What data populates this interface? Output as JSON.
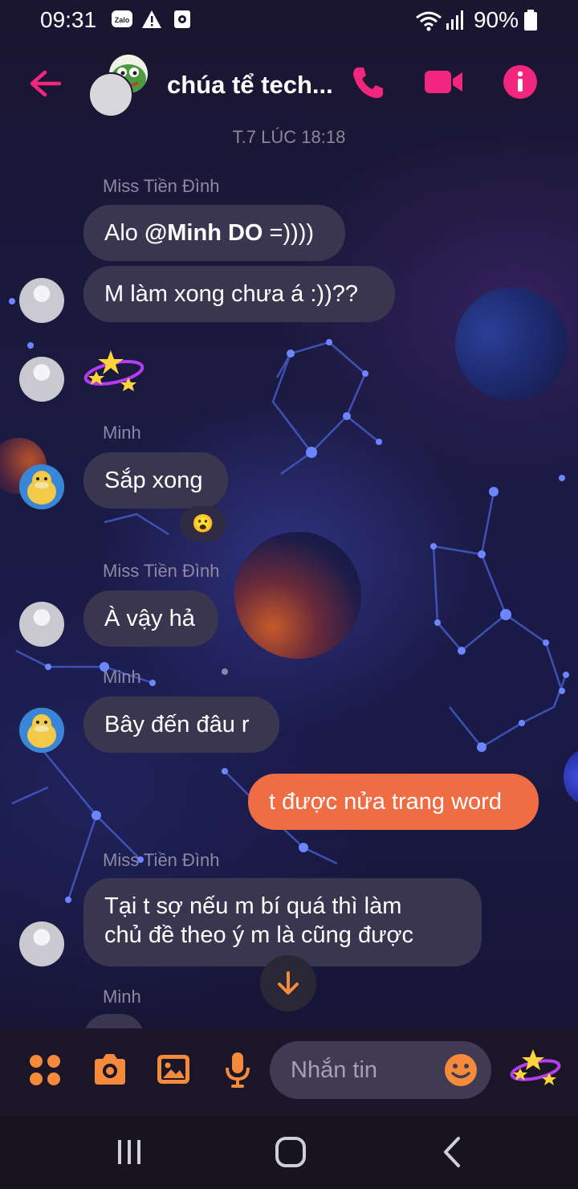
{
  "status_bar": {
    "time": "09:31",
    "battery": "90%",
    "zalo_label": "Zalo",
    "icons": [
      "zalo-icon",
      "alert-icon",
      "screen-record-icon",
      "wifi-icon",
      "signal-icon",
      "battery-icon"
    ]
  },
  "header": {
    "title": "chúa tể tech...",
    "accent": "#f2267f"
  },
  "date_divider": "T.7 LÚC 18:18",
  "messages": [
    {
      "sender": "Miss Tiền Đình"
    },
    {
      "prefix": "Alo ",
      "mention": "@Minh DO",
      "suffix": " =))))"
    },
    {
      "text": "M làm xong chưa á :))??"
    },
    {
      "sender": "Minh"
    },
    {
      "text": "Sắp xong",
      "reaction": "😮"
    },
    {
      "sender": "Miss Tiền Đình"
    },
    {
      "text": "À vậy hả"
    },
    {
      "sender": "Minh"
    },
    {
      "text": "Bây đến đâu r"
    },
    {
      "text": "t được nửa trang word",
      "mine": true
    },
    {
      "sender": "Miss Tiền Đình"
    },
    {
      "line1": "Tại t sợ nếu m bí quá thì làm",
      "line2": "chủ đề theo ý m là cũng được"
    },
    {
      "sender": "Minh"
    }
  ],
  "composer": {
    "placeholder": "Nhắn tin",
    "accent": "#f58a3c",
    "tools": [
      "apps-icon",
      "camera-icon",
      "gallery-icon",
      "mic-icon"
    ]
  },
  "colors": {
    "incoming_bubble": "#3b3650",
    "outgoing_bubble": "#ef6c45"
  }
}
